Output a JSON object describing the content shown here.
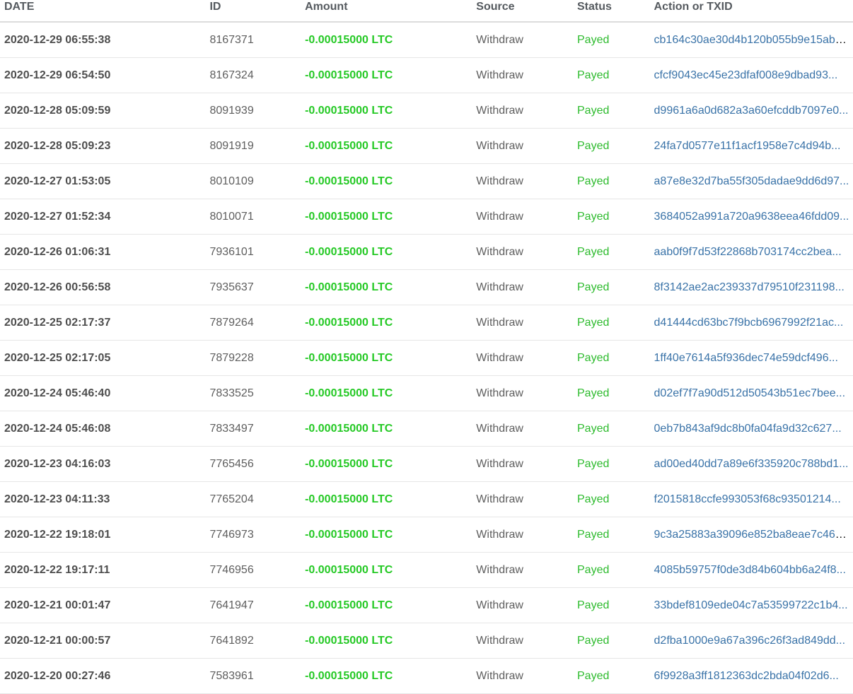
{
  "colors": {
    "amount": "#25c925",
    "status": "#2dbb2d",
    "link": "#3a73a8"
  },
  "table": {
    "headers": [
      "DATE",
      "ID",
      "Amount",
      "Source",
      "Status",
      "Action or TXID"
    ],
    "rows": [
      {
        "date": "2020-12-29 06:55:38",
        "id": "8167371",
        "amount": "-0.00015000 LTC",
        "source": "Withdraw",
        "status": "Payed",
        "txid": "cb164c30ae30d4b120b055b9e15ab9..."
      },
      {
        "date": "2020-12-29 06:54:50",
        "id": "8167324",
        "amount": "-0.00015000 LTC",
        "source": "Withdraw",
        "status": "Payed",
        "txid": "cfcf9043ec45e23dfaf008e9dbad93..."
      },
      {
        "date": "2020-12-28 05:09:59",
        "id": "8091939",
        "amount": "-0.00015000 LTC",
        "source": "Withdraw",
        "status": "Payed",
        "txid": "d9961a6a0d682a3a60efcddb7097e0..."
      },
      {
        "date": "2020-12-28 05:09:23",
        "id": "8091919",
        "amount": "-0.00015000 LTC",
        "source": "Withdraw",
        "status": "Payed",
        "txid": "24fa7d0577e11f1acf1958e7c4d94b..."
      },
      {
        "date": "2020-12-27 01:53:05",
        "id": "8010109",
        "amount": "-0.00015000 LTC",
        "source": "Withdraw",
        "status": "Payed",
        "txid": "a87e8e32d7ba55f305dadae9dd6d97..."
      },
      {
        "date": "2020-12-27 01:52:34",
        "id": "8010071",
        "amount": "-0.00015000 LTC",
        "source": "Withdraw",
        "status": "Payed",
        "txid": "3684052a991a720a9638eea46fdd09..."
      },
      {
        "date": "2020-12-26 01:06:31",
        "id": "7936101",
        "amount": "-0.00015000 LTC",
        "source": "Withdraw",
        "status": "Payed",
        "txid": "aab0f9f7d53f22868b703174cc2bea..."
      },
      {
        "date": "2020-12-26 00:56:58",
        "id": "7935637",
        "amount": "-0.00015000 LTC",
        "source": "Withdraw",
        "status": "Payed",
        "txid": "8f3142ae2ac239337d79510f231198..."
      },
      {
        "date": "2020-12-25 02:17:37",
        "id": "7879264",
        "amount": "-0.00015000 LTC",
        "source": "Withdraw",
        "status": "Payed",
        "txid": "d41444cd63bc7f9bcb6967992f21ac..."
      },
      {
        "date": "2020-12-25 02:17:05",
        "id": "7879228",
        "amount": "-0.00015000 LTC",
        "source": "Withdraw",
        "status": "Payed",
        "txid": "1ff40e7614a5f936dec74e59dcf496..."
      },
      {
        "date": "2020-12-24 05:46:40",
        "id": "7833525",
        "amount": "-0.00015000 LTC",
        "source": "Withdraw",
        "status": "Payed",
        "txid": "d02ef7f7a90d512d50543b51ec7bee..."
      },
      {
        "date": "2020-12-24 05:46:08",
        "id": "7833497",
        "amount": "-0.00015000 LTC",
        "source": "Withdraw",
        "status": "Payed",
        "txid": "0eb7b843af9dc8b0fa04fa9d32c627..."
      },
      {
        "date": "2020-12-23 04:16:03",
        "id": "7765456",
        "amount": "-0.00015000 LTC",
        "source": "Withdraw",
        "status": "Payed",
        "txid": "ad00ed40dd7a89e6f335920c788bd1..."
      },
      {
        "date": "2020-12-23 04:11:33",
        "id": "7765204",
        "amount": "-0.00015000 LTC",
        "source": "Withdraw",
        "status": "Payed",
        "txid": "f2015818ccfe993053f68c93501214..."
      },
      {
        "date": "2020-12-22 19:18:01",
        "id": "7746973",
        "amount": "-0.00015000 LTC",
        "source": "Withdraw",
        "status": "Payed",
        "txid": "9c3a25883a39096e852ba8eae7c46e..."
      },
      {
        "date": "2020-12-22 19:17:11",
        "id": "7746956",
        "amount": "-0.00015000 LTC",
        "source": "Withdraw",
        "status": "Payed",
        "txid": "4085b59757f0de3d84b604bb6a24f8..."
      },
      {
        "date": "2020-12-21 00:01:47",
        "id": "7641947",
        "amount": "-0.00015000 LTC",
        "source": "Withdraw",
        "status": "Payed",
        "txid": "33bdef8109ede04c7a53599722c1b4..."
      },
      {
        "date": "2020-12-21 00:00:57",
        "id": "7641892",
        "amount": "-0.00015000 LTC",
        "source": "Withdraw",
        "status": "Payed",
        "txid": "d2fba1000e9a67a396c26f3ad849dd..."
      },
      {
        "date": "2020-12-20 00:27:46",
        "id": "7583961",
        "amount": "-0.00015000 LTC",
        "source": "Withdraw",
        "status": "Payed",
        "txid": "6f9928a3ff1812363dc2bda04f02d6..."
      }
    ]
  }
}
